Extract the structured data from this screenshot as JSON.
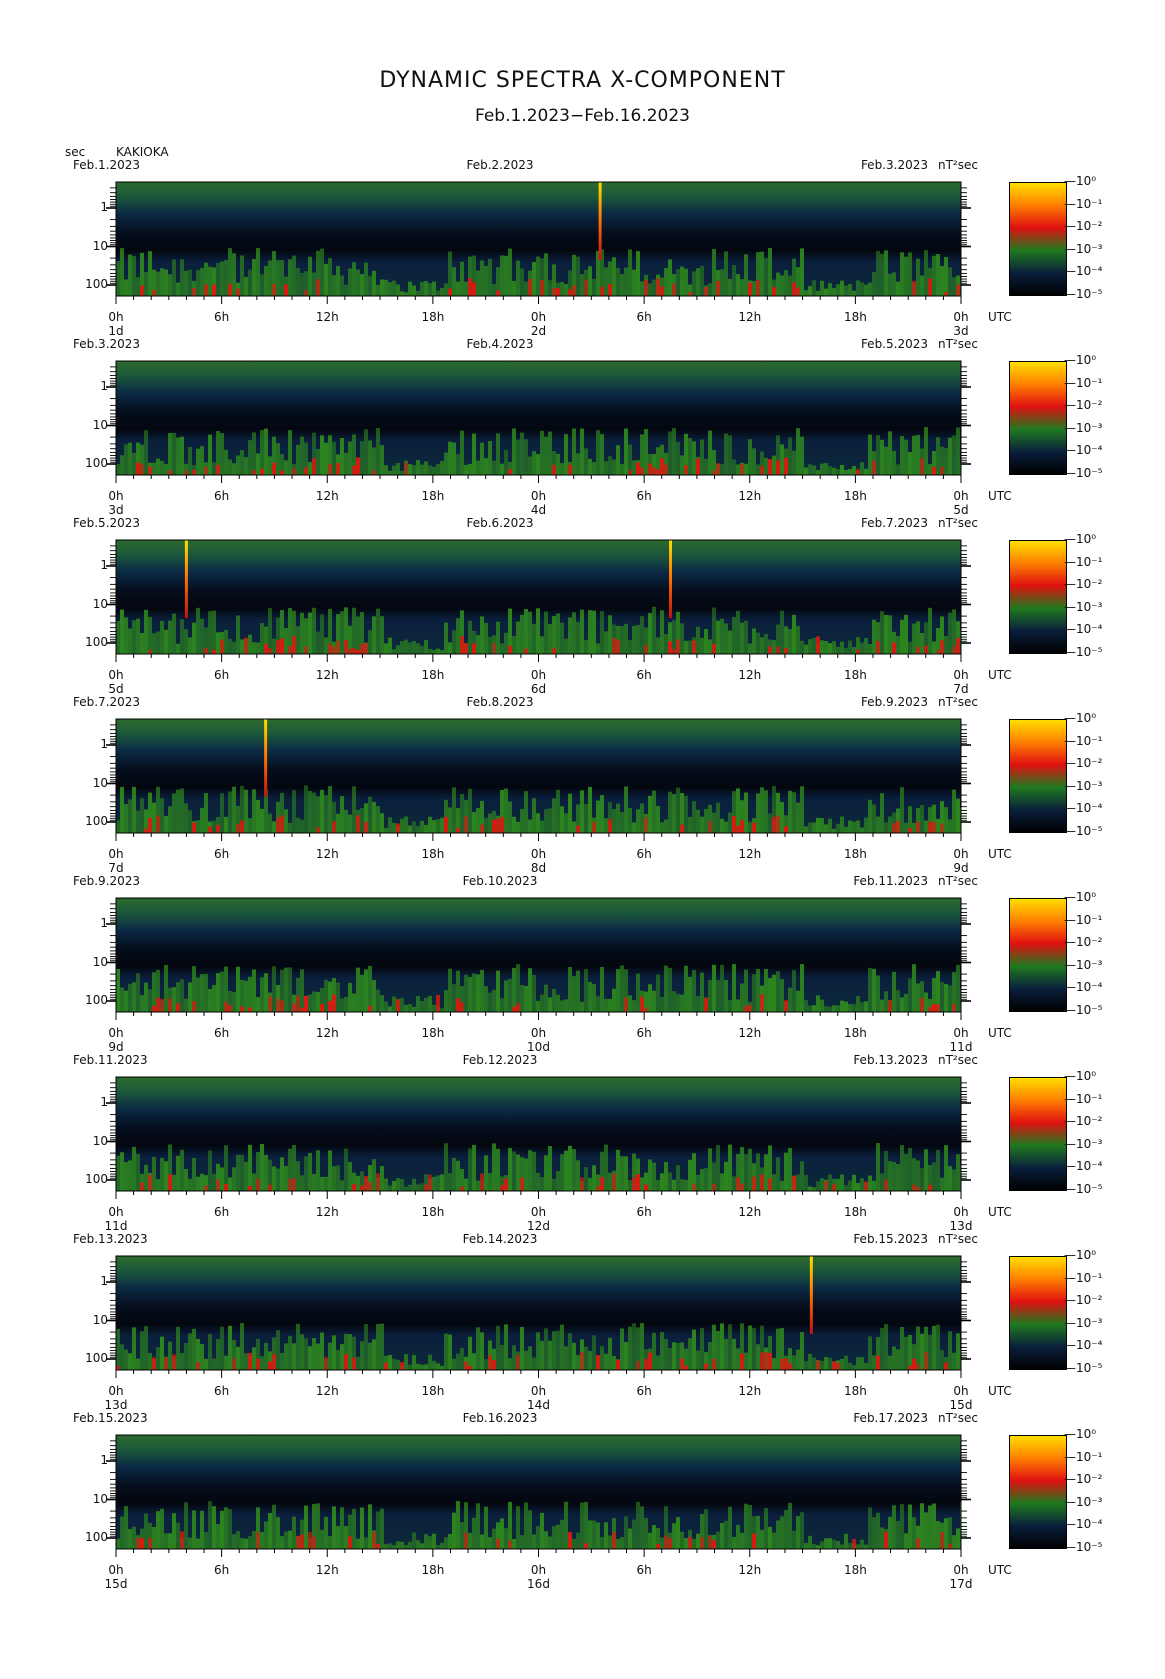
{
  "title": "DYNAMIC SPECTRA X-COMPONENT",
  "subtitle": "Feb.1.2023−Feb.16.2023",
  "y_unit": "sec",
  "station": "KAKIOKA",
  "colorbar_unit": "nT²sec",
  "time_zone": "UTC",
  "colors": {
    "low": "#000000",
    "mid_low": "#0a1f3c",
    "mid": "#1f7a1f",
    "high": "#e01010",
    "max": "#ffe000"
  },
  "chart_data": {
    "type": "heatmap",
    "title": "DYNAMIC SPECTRA X-COMPONENT",
    "subtitle": "Feb.1.2023−Feb.16.2023",
    "ylabel": "sec",
    "y_scale": "log",
    "y_ticks": [
      "1",
      "10",
      "100"
    ],
    "x_ticks": [
      "0h",
      "6h",
      "12h",
      "18h",
      "0h",
      "6h",
      "12h",
      "18h",
      "0h"
    ],
    "colorbar": {
      "unit": "nT²sec",
      "scale": "log",
      "tick_labels": [
        "10⁰",
        "10⁻¹",
        "10⁻²",
        "10⁻³",
        "10⁻⁴",
        "10⁻⁵"
      ],
      "colors": [
        "#ffe000",
        "#ff8000",
        "#e01010",
        "#1f7a1f",
        "#0a1f3c",
        "#000000"
      ]
    },
    "panels": [
      {
        "start": "Feb.1.2023",
        "mid": "Feb.2.2023",
        "end": "Feb.3.2023",
        "day_start": "1d",
        "day_mid": "2d",
        "day_end": "3d",
        "spikes_hours": [
          27.5
        ]
      },
      {
        "start": "Feb.3.2023",
        "mid": "Feb.4.2023",
        "end": "Feb.5.2023",
        "day_start": "3d",
        "day_mid": "4d",
        "day_end": "5d",
        "spikes_hours": []
      },
      {
        "start": "Feb.5.2023",
        "mid": "Feb.6.2023",
        "end": "Feb.7.2023",
        "day_start": "5d",
        "day_mid": "6d",
        "day_end": "7d",
        "spikes_hours": [
          4.0,
          31.5
        ]
      },
      {
        "start": "Feb.7.2023",
        "mid": "Feb.8.2023",
        "end": "Feb.9.2023",
        "day_start": "7d",
        "day_mid": "8d",
        "day_end": "9d",
        "spikes_hours": [
          8.5
        ]
      },
      {
        "start": "Feb.9.2023",
        "mid": "Feb.10.2023",
        "end": "Feb.11.2023",
        "day_start": "9d",
        "day_mid": "10d",
        "day_end": "11d",
        "spikes_hours": []
      },
      {
        "start": "Feb.11.2023",
        "mid": "Feb.12.2023",
        "end": "Feb.13.2023",
        "day_start": "11d",
        "day_mid": "12d",
        "day_end": "13d",
        "spikes_hours": []
      },
      {
        "start": "Feb.13.2023",
        "mid": "Feb.14.2023",
        "end": "Feb.15.2023",
        "day_start": "13d",
        "day_mid": "14d",
        "day_end": "15d",
        "spikes_hours": [
          39.5
        ]
      },
      {
        "start": "Feb.15.2023",
        "mid": "Feb.16.2023",
        "end": "Feb.17.2023",
        "day_start": "15d",
        "day_mid": "16d",
        "day_end": "17d",
        "spikes_hours": []
      }
    ]
  }
}
